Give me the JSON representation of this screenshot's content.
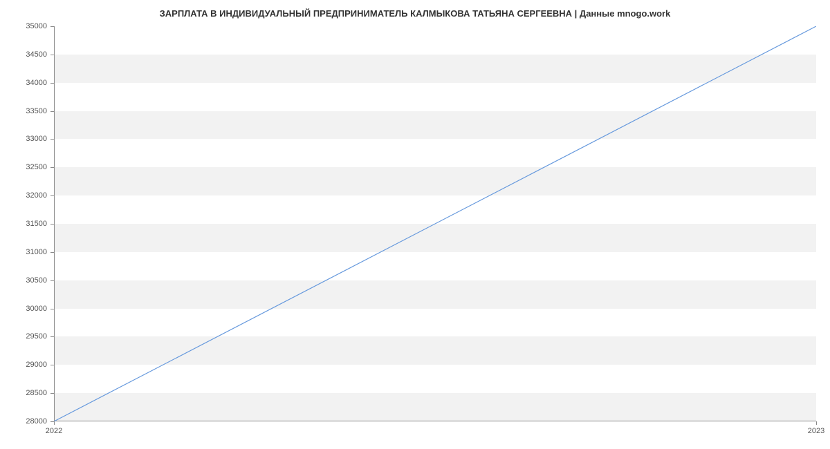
{
  "chart_data": {
    "type": "line",
    "title": "ЗАРПЛАТА В ИНДИВИДУАЛЬНЫЙ ПРЕДПРИНИМАТЕЛЬ  КАЛМЫКОВА ТАТЬЯНА СЕРГЕЕВНА | Данные mnogo.work",
    "xlabel": "",
    "ylabel": "",
    "x": [
      "2022",
      "2023"
    ],
    "series": [
      {
        "name": "salary",
        "values": [
          28000,
          35000
        ],
        "color": "#6699dd"
      }
    ],
    "xlim": [
      "2022",
      "2023"
    ],
    "ylim": [
      28000,
      35000
    ],
    "y_ticks": [
      28000,
      28500,
      29000,
      29500,
      30000,
      30500,
      31000,
      31500,
      32000,
      32500,
      33000,
      33500,
      34000,
      34500,
      35000
    ],
    "x_ticks": [
      "2022",
      "2023"
    ],
    "grid": true
  }
}
